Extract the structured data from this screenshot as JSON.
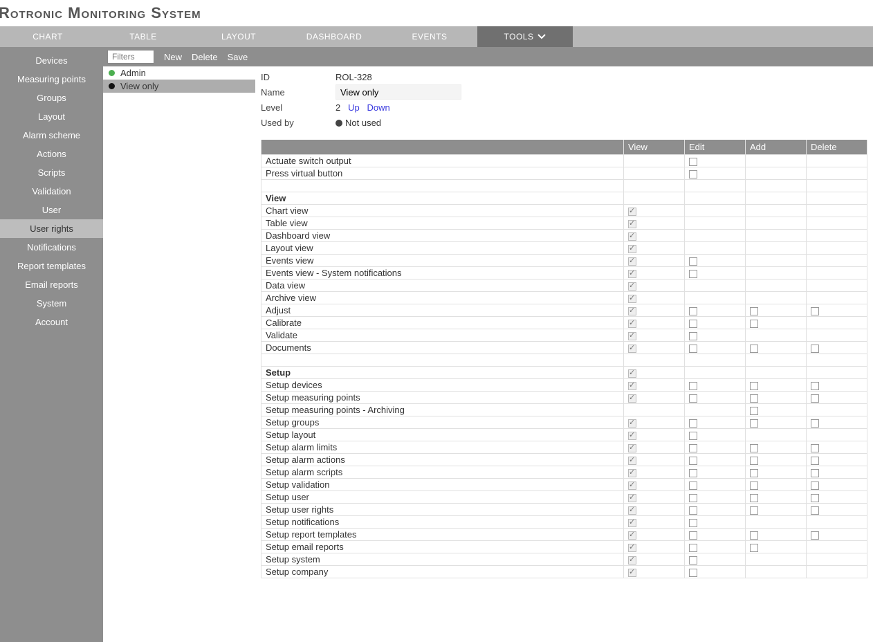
{
  "app_title": "Rotronic Monitoring System",
  "topnav": {
    "items": [
      "CHART",
      "TABLE",
      "LAYOUT",
      "DASHBOARD",
      "EVENTS",
      "TOOLS"
    ],
    "active_index": 5
  },
  "sidebar": {
    "items": [
      "Devices",
      "Measuring points",
      "Groups",
      "Layout",
      "Alarm scheme",
      "Actions",
      "Scripts",
      "Validation",
      "User",
      "User rights",
      "Notifications",
      "Report templates",
      "Email reports",
      "System",
      "Account"
    ],
    "active_index": 9
  },
  "toolbar": {
    "filters_placeholder": "Filters",
    "new_label": "New",
    "delete_label": "Delete",
    "save_label": "Save"
  },
  "roles": {
    "items": [
      {
        "name": "Admin",
        "dot": "green",
        "selected": false
      },
      {
        "name": "View only",
        "dot": "black",
        "selected": true
      }
    ]
  },
  "details": {
    "labels": {
      "id": "ID",
      "name": "Name",
      "level": "Level",
      "used_by": "Used by"
    },
    "id": "ROL-328",
    "name": "View only",
    "level_value": "2",
    "level_up": "Up",
    "level_down": "Down",
    "used_by": "Not used"
  },
  "perm_table": {
    "headers": [
      "",
      "View",
      "Edit",
      "Add",
      "Delete"
    ],
    "rows": [
      {
        "type": "item",
        "label": "Actuate switch output",
        "view": null,
        "edit": "unchecked",
        "add": null,
        "delete": null
      },
      {
        "type": "item",
        "label": "Press virtual button",
        "view": null,
        "edit": "unchecked",
        "add": null,
        "delete": null
      },
      {
        "type": "blank"
      },
      {
        "type": "section",
        "label": "View"
      },
      {
        "type": "item",
        "label": "Chart view",
        "view": "checked_disabled",
        "edit": null,
        "add": null,
        "delete": null
      },
      {
        "type": "item",
        "label": "Table view",
        "view": "checked_disabled",
        "edit": null,
        "add": null,
        "delete": null
      },
      {
        "type": "item",
        "label": "Dashboard view",
        "view": "checked_disabled",
        "edit": null,
        "add": null,
        "delete": null
      },
      {
        "type": "item",
        "label": "Layout view",
        "view": "checked_disabled",
        "edit": null,
        "add": null,
        "delete": null
      },
      {
        "type": "item",
        "label": "Events view",
        "view": "checked_disabled",
        "edit": "unchecked",
        "add": null,
        "delete": null
      },
      {
        "type": "item",
        "label": "Events view - System notifications",
        "view": "checked_disabled",
        "edit": "unchecked",
        "add": null,
        "delete": null
      },
      {
        "type": "item",
        "label": "Data view",
        "view": "checked_disabled",
        "edit": null,
        "add": null,
        "delete": null
      },
      {
        "type": "item",
        "label": "Archive view",
        "view": "checked_disabled",
        "edit": null,
        "add": null,
        "delete": null
      },
      {
        "type": "item",
        "label": "Adjust",
        "view": "checked_disabled",
        "edit": "unchecked",
        "add": "unchecked",
        "delete": "unchecked"
      },
      {
        "type": "item",
        "label": "Calibrate",
        "view": "checked_disabled",
        "edit": "unchecked",
        "add": "unchecked",
        "delete": null
      },
      {
        "type": "item",
        "label": "Validate",
        "view": "checked_disabled",
        "edit": "unchecked",
        "add": null,
        "delete": null
      },
      {
        "type": "item",
        "label": "Documents",
        "view": "checked_disabled",
        "edit": "unchecked",
        "add": "unchecked",
        "delete": "unchecked"
      },
      {
        "type": "blank"
      },
      {
        "type": "section",
        "label": "Setup",
        "view": "checked_disabled"
      },
      {
        "type": "item",
        "label": "Setup devices",
        "view": "checked_disabled",
        "edit": "unchecked",
        "add": "unchecked",
        "delete": "unchecked"
      },
      {
        "type": "item",
        "label": "Setup measuring points",
        "view": "checked_disabled",
        "edit": "unchecked",
        "add": "unchecked",
        "delete": "unchecked"
      },
      {
        "type": "item",
        "label": "Setup measuring points - Archiving",
        "view": null,
        "edit": null,
        "add": "unchecked",
        "delete": null
      },
      {
        "type": "item",
        "label": "Setup groups",
        "view": "checked_disabled",
        "edit": "unchecked",
        "add": "unchecked",
        "delete": "unchecked"
      },
      {
        "type": "item",
        "label": "Setup layout",
        "view": "checked_disabled",
        "edit": "unchecked",
        "add": null,
        "delete": null
      },
      {
        "type": "item",
        "label": "Setup alarm limits",
        "view": "checked_disabled",
        "edit": "unchecked",
        "add": "unchecked",
        "delete": "unchecked"
      },
      {
        "type": "item",
        "label": "Setup alarm actions",
        "view": "checked_disabled",
        "edit": "unchecked",
        "add": "unchecked",
        "delete": "unchecked"
      },
      {
        "type": "item",
        "label": "Setup alarm scripts",
        "view": "checked_disabled",
        "edit": "unchecked",
        "add": "unchecked",
        "delete": "unchecked"
      },
      {
        "type": "item",
        "label": "Setup validation",
        "view": "checked_disabled",
        "edit": "unchecked",
        "add": "unchecked",
        "delete": "unchecked"
      },
      {
        "type": "item",
        "label": "Setup user",
        "view": "checked_disabled",
        "edit": "unchecked",
        "add": "unchecked",
        "delete": "unchecked"
      },
      {
        "type": "item",
        "label": "Setup user rights",
        "view": "checked_disabled",
        "edit": "unchecked",
        "add": "unchecked",
        "delete": "unchecked"
      },
      {
        "type": "item",
        "label": "Setup notifications",
        "view": "checked_disabled",
        "edit": "unchecked",
        "add": null,
        "delete": null
      },
      {
        "type": "item",
        "label": "Setup report templates",
        "view": "checked_disabled",
        "edit": "unchecked",
        "add": "unchecked",
        "delete": "unchecked"
      },
      {
        "type": "item",
        "label": "Setup email reports",
        "view": "checked_disabled",
        "edit": "unchecked",
        "add": "unchecked",
        "delete": null
      },
      {
        "type": "item",
        "label": "Setup system",
        "view": "checked_disabled",
        "edit": "unchecked",
        "add": null,
        "delete": null
      },
      {
        "type": "item",
        "label": "Setup company",
        "view": "checked_disabled",
        "edit": "unchecked",
        "add": null,
        "delete": null
      }
    ]
  }
}
